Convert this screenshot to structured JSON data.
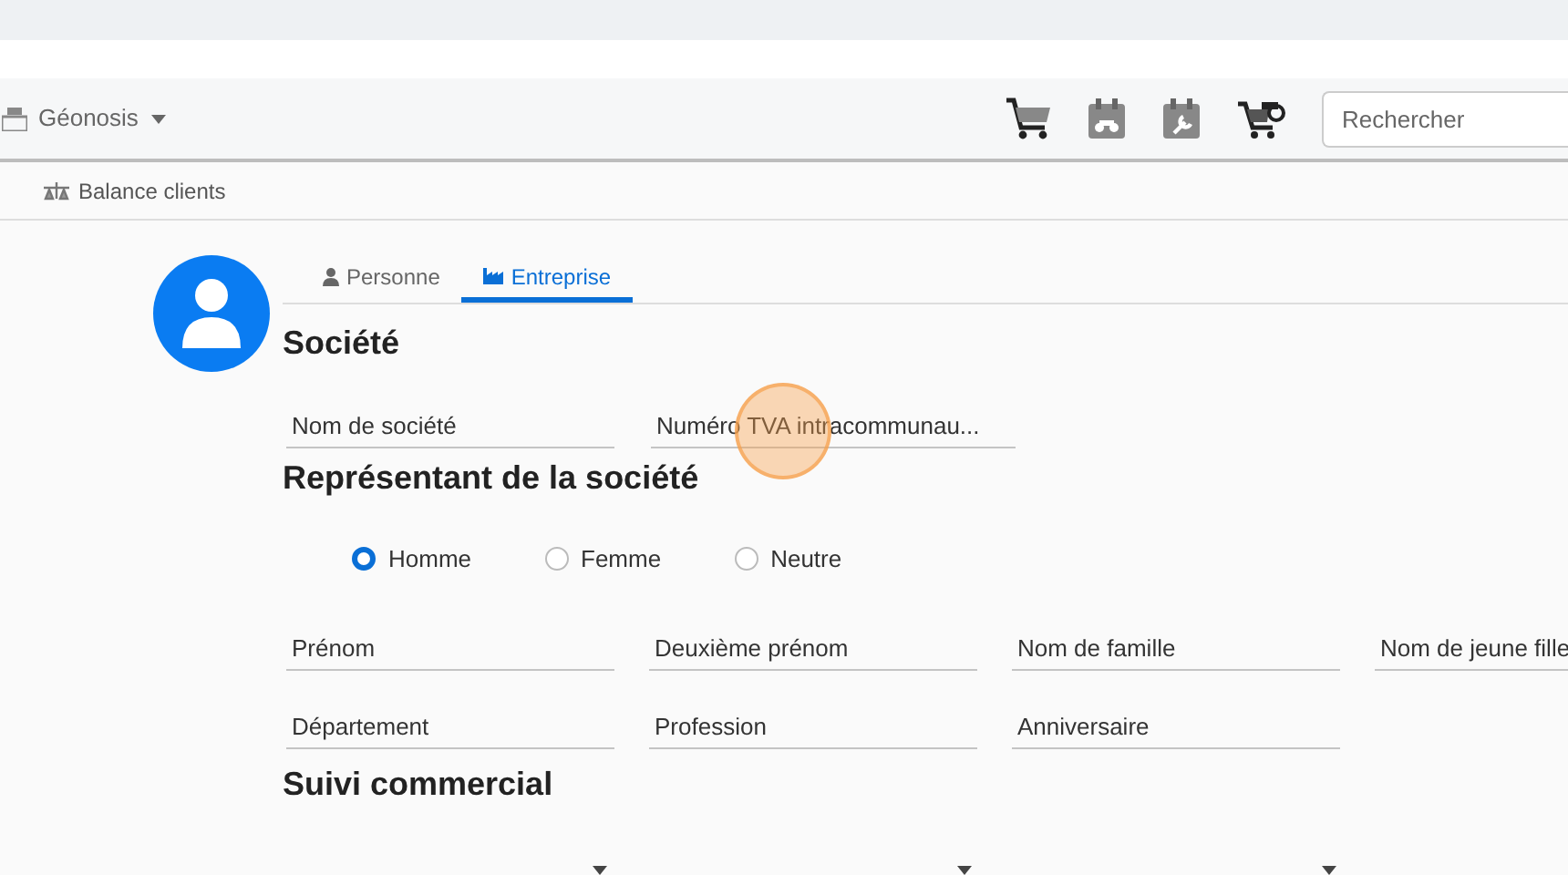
{
  "toolbar": {
    "company": "Géonosis",
    "search": {
      "placeholder": "Rechercher"
    }
  },
  "subbar": {
    "link": "Balance clients"
  },
  "tabs": [
    {
      "label": "Personne",
      "selected": false
    },
    {
      "label": "Entreprise",
      "selected": true
    }
  ],
  "societe": {
    "title": "Société",
    "fields": [
      {
        "placeholder": "Nom de société"
      },
      {
        "placeholder": "Numéro TVA intracommunau..."
      }
    ]
  },
  "representant": {
    "title": "Représentant de la société",
    "genders": [
      {
        "label": "Homme",
        "selected": true
      },
      {
        "label": "Femme",
        "selected": false
      },
      {
        "label": "Neutre",
        "selected": false
      }
    ],
    "fields": [
      {
        "placeholder": "Prénom"
      },
      {
        "placeholder": "Deuxième prénom"
      },
      {
        "placeholder": "Nom de famille"
      },
      {
        "placeholder": "Nom de jeune fille"
      },
      {
        "placeholder": "Département"
      },
      {
        "placeholder": "Profession"
      },
      {
        "placeholder": "Anniversaire"
      }
    ]
  },
  "suivi": {
    "title": "Suivi commercial",
    "selects": [
      {
        "kind": "dropdown"
      },
      {
        "kind": "dropdown"
      },
      {
        "kind": "dropdown"
      }
    ]
  }
}
